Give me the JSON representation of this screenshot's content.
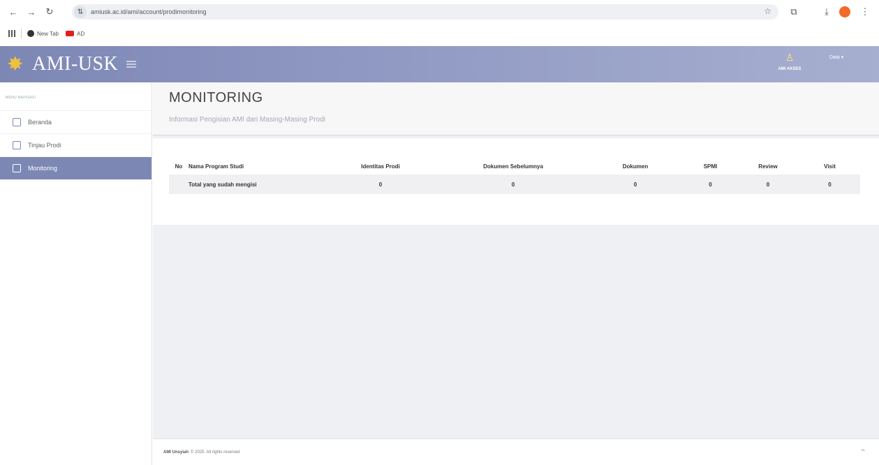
{
  "browser": {
    "url": "amiusk.ac.id/ami/account/prodimonitoring",
    "bookmarks": [
      "New Tab",
      "AD"
    ]
  },
  "header": {
    "app_name": "AMI-USK",
    "user_label": "AMI AKSES",
    "menu_label": "Data"
  },
  "sidebar": {
    "heading": "MENU NAVIGASI",
    "items": [
      {
        "label": "Beranda",
        "active": false
      },
      {
        "label": "Tinjau Prodi",
        "active": false
      },
      {
        "label": "Monitoring",
        "active": true
      }
    ]
  },
  "main": {
    "title": "MONITORING",
    "subtitle": "Informasi Pengisian AMI dari Masing-Masing Prodi",
    "table": {
      "headers": [
        "No",
        "Nama Program Studi",
        "Identitas Prodi",
        "Dokumen Sebelumnya",
        "Dokumen",
        "SPMI",
        "Review",
        "Visit"
      ],
      "total_row": {
        "label": "Total yang sudah mengisi",
        "values": [
          "0",
          "0",
          "0",
          "0",
          "0",
          "0"
        ]
      }
    }
  },
  "footer": {
    "brand": "AMI Unsyiah",
    "text": "© 2025. All rights reserved"
  },
  "colors": {
    "accent": "#7d87b4",
    "header_gradient_end": "#a7afd0"
  }
}
